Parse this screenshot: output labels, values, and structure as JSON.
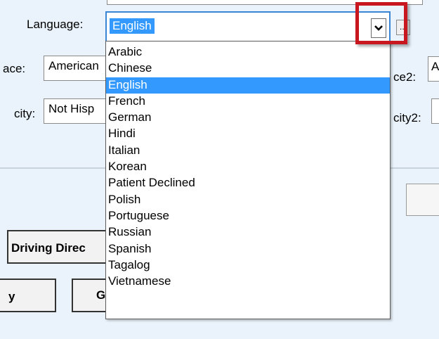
{
  "form": {
    "language_label": "Language:",
    "race_label": "ace:",
    "race_value": "American",
    "ethnicity_label": "city:",
    "ethnicity_value": "Not Hisp",
    "race2_label": "ce2:",
    "race2_value": "A",
    "ethnicity2_label": "city2:",
    "language_combo": {
      "selected_value": "English",
      "ellipsis_label": "..."
    }
  },
  "dropdown": {
    "options": [
      "Arabic",
      "Chinese",
      "English",
      "French",
      "German",
      "Hindi",
      "Italian",
      "Korean",
      "Patient Declined",
      "Polish",
      "Portuguese",
      "Russian",
      "Spanish",
      "Tagalog",
      "Vietnamese"
    ],
    "selected_index": 2
  },
  "buttons": {
    "driving_directions": "Driving Direc",
    "left_partial": "y",
    "middle_partial": "G"
  },
  "colors": {
    "panel_bg": "#eaf3fb",
    "selection": "#3399ff",
    "highlight_box": "#c8171e"
  }
}
